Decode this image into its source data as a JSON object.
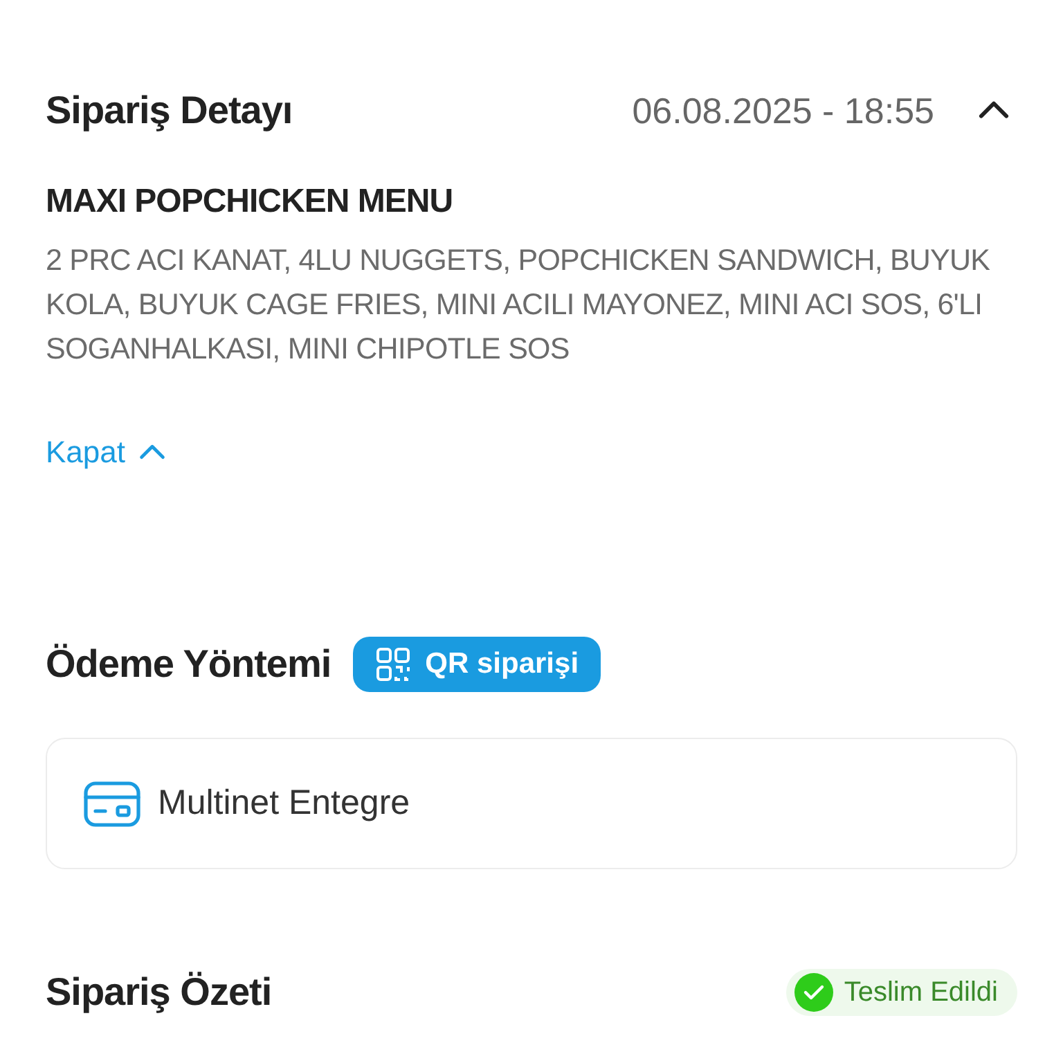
{
  "order_detail": {
    "title": "Sipariş Detayı",
    "date": "06.08.2025 - 18:55",
    "expanded": true,
    "item_name": "MAXI POPCHICKEN MENU",
    "item_description": "2 PRC ACI KANAT, 4LU NUGGETS, POPCHICKEN SANDWICH, BUYUK KOLA, BUYUK CAGE FRIES, MINI ACILI MAYONEZ, MINI ACI SOS, 6'LI SOGANHALKASI, MINI CHIPOTLE SOS",
    "collapse_link": "Kapat"
  },
  "payment": {
    "title": "Ödeme Yöntemi",
    "badge": "QR siparişi",
    "method": "Multinet Entegre"
  },
  "summary": {
    "title": "Sipariş Özeti",
    "status": "Teslim Edildi"
  }
}
